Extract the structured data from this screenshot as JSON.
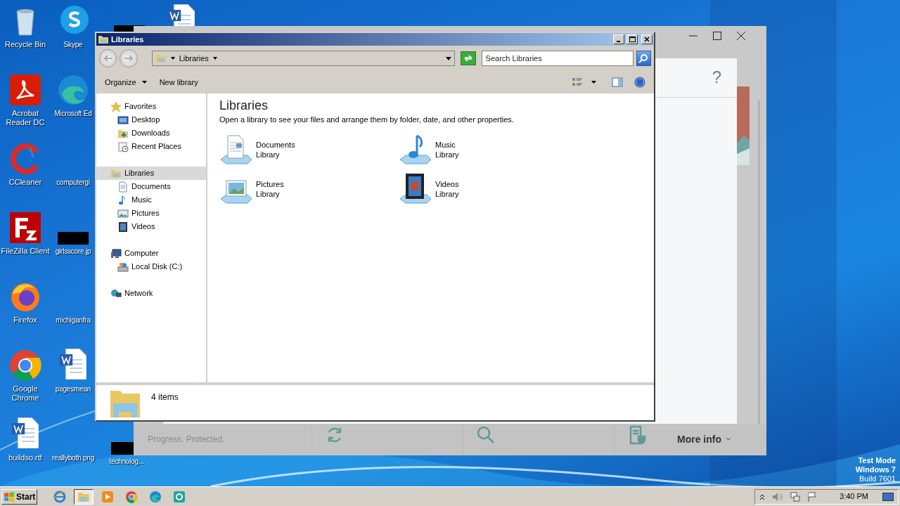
{
  "desktop": {
    "columns": [
      {
        "icons": [
          {
            "label": "Recycle Bin",
            "kind": "recycle"
          },
          {
            "label": "Acrobat Reader DC",
            "kind": "pdf"
          },
          {
            "label": "CCleaner",
            "kind": "ccleaner"
          },
          {
            "label": "FileZilla Client",
            "kind": "filezilla"
          },
          {
            "label": "Firefox",
            "kind": "firefox"
          },
          {
            "label": "Google Chrome",
            "kind": "chrome"
          },
          {
            "label": "buildso.rtf",
            "kind": "word"
          }
        ]
      },
      {
        "icons": [
          {
            "label": "Skype",
            "kind": "skype"
          },
          {
            "label": "Microsoft Ed",
            "kind": "edge"
          },
          {
            "label": "computergi",
            "kind": "blank"
          },
          {
            "label": "girlsscore.jp",
            "kind": "redacted"
          },
          {
            "label": "michiganfra",
            "kind": "blank"
          },
          {
            "label": "pagesmean",
            "kind": "word"
          },
          {
            "label": "reallyboth.png",
            "kind": "blank"
          }
        ]
      },
      {
        "icons": [
          {
            "kind": "redacted"
          }
        ]
      },
      {
        "icons": [
          {
            "kind": "word"
          }
        ]
      }
    ],
    "bottom_icon": {
      "label": "technolog...",
      "kind": "redacted"
    },
    "system_notice": [
      "Test Mode",
      "Windows 7",
      "Build 7601"
    ]
  },
  "background_window": {
    "help": "?",
    "status": "Progress. Protected.",
    "tiles": [
      {
        "kind": "refresh"
      },
      {
        "kind": "search"
      },
      {
        "kind": "shield"
      }
    ],
    "more_info": "More info"
  },
  "explorer": {
    "title": "Libraries",
    "breadcrumb": "Libraries",
    "search": {
      "placeholder": "Search Libraries"
    },
    "toolbar": [
      {
        "label": "Organize",
        "menu": true
      },
      {
        "label": "New library",
        "menu": false
      }
    ],
    "nav": [
      {
        "label": "Favorites",
        "kind": "star",
        "selected": false,
        "children": [
          {
            "label": "Desktop",
            "kind": "desktop",
            "selected": false
          },
          {
            "label": "Downloads",
            "kind": "downloads",
            "selected": false
          },
          {
            "label": "Recent Places",
            "kind": "recent",
            "selected": false
          }
        ]
      },
      {
        "label": "Libraries",
        "kind": "library",
        "selected": true,
        "children": [
          {
            "label": "Documents",
            "kind": "documents",
            "selected": false
          },
          {
            "label": "Music",
            "kind": "music",
            "selected": false
          },
          {
            "label": "Pictures",
            "kind": "pictures",
            "selected": false
          },
          {
            "label": "Videos",
            "kind": "videos",
            "selected": false
          }
        ]
      },
      {
        "label": "Computer",
        "kind": "computer",
        "selected": false,
        "children": [
          {
            "label": "Local Disk (C:)",
            "kind": "disk",
            "selected": false
          }
        ]
      },
      {
        "label": "Network",
        "kind": "network",
        "selected": false
      }
    ],
    "content": {
      "title": "Libraries",
      "description": "Open a library to see your files and arrange them by folder, date, and other properties.",
      "items": [
        {
          "name": "Documents",
          "type": "Library",
          "kind": "documents"
        },
        {
          "name": "Music",
          "type": "Library",
          "kind": "music"
        },
        {
          "name": "Pictures",
          "type": "Library",
          "kind": "pictures"
        },
        {
          "name": "Videos",
          "type": "Library",
          "kind": "videos"
        }
      ]
    },
    "details": {
      "summary": "4 items"
    }
  },
  "taskbar": {
    "start": "Start",
    "apps": [
      {
        "kind": "ie",
        "selected": false
      },
      {
        "kind": "explorer",
        "selected": true
      },
      {
        "kind": "media",
        "selected": false
      },
      {
        "kind": "chrome",
        "selected": false
      },
      {
        "kind": "edge",
        "selected": false
      },
      {
        "kind": "eset",
        "selected": false
      }
    ],
    "clock": "3:40 PM"
  }
}
